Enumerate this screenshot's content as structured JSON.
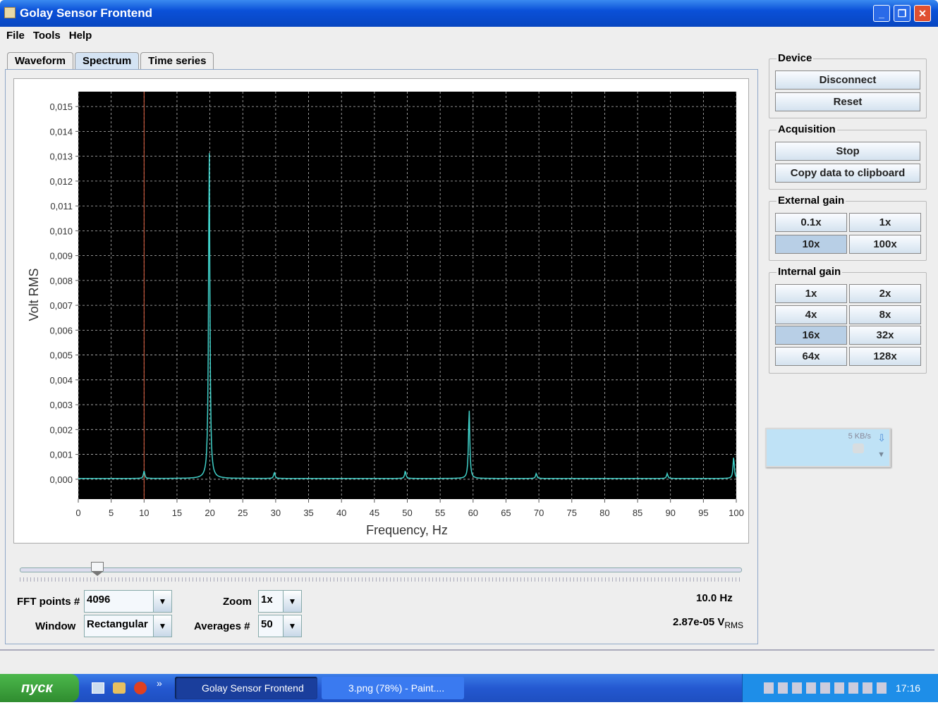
{
  "window": {
    "title": "Golay Sensor Frontend",
    "minimize": "_",
    "maximize": "❐",
    "close": "✕"
  },
  "menu": [
    "File",
    "Tools",
    "Help"
  ],
  "tabs": [
    {
      "label": "Waveform",
      "active": false
    },
    {
      "label": "Spectrum",
      "active": true
    },
    {
      "label": "Time series",
      "active": false
    }
  ],
  "chart_data": {
    "type": "line",
    "xlabel": "Frequency, Hz",
    "ylabel": "Volt RMS",
    "xlim": [
      0,
      100
    ],
    "ylim": [
      -0.0008,
      0.0156
    ],
    "xticks": [
      "0",
      "5",
      "10",
      "15",
      "20",
      "25",
      "30",
      "35",
      "40",
      "45",
      "50",
      "55",
      "60",
      "65",
      "70",
      "75",
      "80",
      "85",
      "90",
      "95",
      "100"
    ],
    "yticks": [
      "0,000",
      "0,001",
      "0,002",
      "0,003",
      "0,004",
      "0,005",
      "0,006",
      "0,007",
      "0,008",
      "0,009",
      "0,010",
      "0,011",
      "0,012",
      "0,013",
      "0,014",
      "0,015"
    ],
    "grid": true,
    "background": "#000000",
    "series_color": "#40d0c8",
    "cursor": {
      "x": 10.0,
      "color": "#e06040"
    },
    "peaks": [
      {
        "x": 10,
        "y": 0.0003
      },
      {
        "x": 19.9,
        "y": 0.01335
      },
      {
        "x": 29.8,
        "y": 0.00025
      },
      {
        "x": 49.7,
        "y": 0.0003
      },
      {
        "x": 59.4,
        "y": 0.00278
      },
      {
        "x": 69.6,
        "y": 0.0002
      },
      {
        "x": 89.5,
        "y": 0.0002
      },
      {
        "x": 99.6,
        "y": 0.00085
      }
    ]
  },
  "slider": {
    "value_hz": 10.0
  },
  "controls": {
    "fft_label": "FFT points #",
    "fft_value": "4096",
    "window_label": "Window",
    "window_value": "Rectangular",
    "zoom_label": "Zoom",
    "zoom_value": "1x",
    "avg_label": "Averages #",
    "avg_value": "50",
    "freq_readout": "10.0 Hz",
    "amp_readout": "2.87e-05 V",
    "amp_unit": "RMS",
    "arrow": "▼"
  },
  "device": {
    "title": "Device",
    "disconnect": "Disconnect",
    "reset": "Reset"
  },
  "acquisition": {
    "title": "Acquisition",
    "stop": "Stop",
    "copy": "Copy data to clipboard"
  },
  "external_gain": {
    "title": "External gain",
    "options": [
      "0.1x",
      "1x",
      "10x",
      "100x"
    ],
    "selected": "10x"
  },
  "internal_gain": {
    "title": "Internal gain",
    "options": [
      "1x",
      "2x",
      "4x",
      "8x",
      "16x",
      "32x",
      "64x",
      "128x"
    ],
    "selected": "16x"
  },
  "net_widget": {
    "rate": "5 KB/s"
  },
  "taskbar": {
    "start": "пуск",
    "tasks": [
      "Golay Sensor Frontend",
      "3.png (78%) - Paint...."
    ],
    "clock": "17:16",
    "quicklaunch_more": "»"
  }
}
